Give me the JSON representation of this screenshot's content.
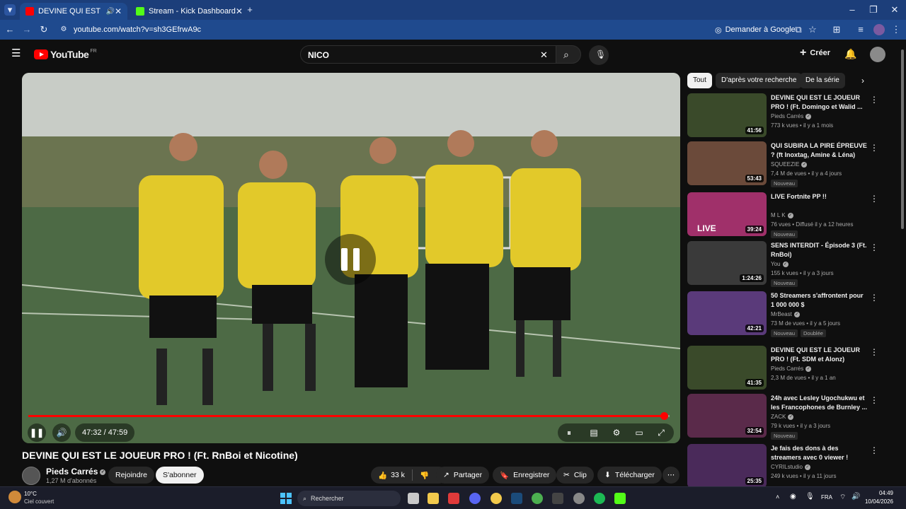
{
  "browser": {
    "tabs": [
      {
        "title": "DEVINE QUI EST LE JOUEUR",
        "active": true
      },
      {
        "title": "Stream - Kick Dashboard",
        "active": false
      }
    ],
    "url": "youtube.com/watch?v=sh3GEfrwA9c",
    "google_button": "Demander à Google"
  },
  "youtube": {
    "logo_text": "YouTube",
    "logo_region": "FR",
    "search_value": "NICO",
    "create_label": "Créer"
  },
  "player": {
    "time": "47:32 / 47:59",
    "progress": 0.991
  },
  "video": {
    "title": "DEVINE QUI EST LE JOUEUR PRO ! (Ft. RnBoi et Nicotine)",
    "channel": "Pieds Carrés",
    "subscribers": "1,27 M d'abonnés",
    "join_label": "Rejoindre",
    "subscribe_label": "S'abonner",
    "likes": "33 k",
    "share_label": "Partager",
    "save_label": "Enregistrer",
    "clip_label": "Clip",
    "download_label": "Télécharger"
  },
  "chips": [
    "Tout",
    "D'après votre recherche",
    "De la série"
  ],
  "recommendations": [
    {
      "title": "DEVINE QUI EST LE JOUEUR PRO ! (Ft. Domingo et Walid ...",
      "channel": "Pieds Carrés",
      "meta": "773 k vues • il y a 1 mois",
      "duration": "41:56",
      "badge": "",
      "badge2": "",
      "thumb_color": "#3a4a2a"
    },
    {
      "title": "QUI SUBIRA LA PIRE ÉPREUVE ? (ft Inoxtag, Amine & Léna)",
      "channel": "SQUEEZIE",
      "meta": "7,4 M de vues • il y a 4 jours",
      "duration": "53:43",
      "badge": "Nouveau",
      "badge2": "",
      "thumb_color": "#6b4a3a"
    },
    {
      "title": "LIVE Fortnite PP !!",
      "channel": "M L K",
      "meta": "76 vues • Diffusé il y a 12 heures",
      "duration": "39:24",
      "badge": "Nouveau",
      "badge2": "",
      "thumb_color": "#a0306a",
      "thumb_text": "LIVE"
    },
    {
      "title": "SENS INTERDIT - Épisode 3 (Ft. RnBoi)",
      "channel": "You",
      "meta": "155 k vues • il y a 3 jours",
      "duration": "1:24:26",
      "badge": "Nouveau",
      "badge2": "",
      "thumb_color": "#3a3a3a"
    },
    {
      "title": "50 Streamers s'affrontent pour 1 000 000 $",
      "channel": "MrBeast",
      "meta": "73 M de vues • il y a 5 jours",
      "duration": "42:21",
      "badge": "Nouveau",
      "badge2": "Doublée",
      "thumb_color": "#5a3a7a"
    },
    {
      "title": "DEVINE QUI EST LE JOUEUR PRO ! (Ft. SDM et Alonz)",
      "channel": "Pieds Carrés",
      "meta": "2,3 M de vues • il y a 1 an",
      "duration": "41:35",
      "badge": "",
      "badge2": "",
      "thumb_color": "#3a4a2a"
    },
    {
      "title": "24h avec Lesley Ugochukwu et les Francophones de Burnley ...",
      "channel": "ZACK",
      "meta": "79 k vues • il y a 3 jours",
      "duration": "32:54",
      "badge": "Nouveau",
      "badge2": "",
      "thumb_color": "#5a2a4a"
    },
    {
      "title": "Je fais des dons à des streamers avec 0 viewer !",
      "channel": "CYRILstudio",
      "meta": "249 k vues • il y a 11 jours",
      "duration": "25:35",
      "badge": "",
      "badge2": "",
      "thumb_color": "#4a2a5a"
    }
  ],
  "taskbar": {
    "weather_temp": "10°C",
    "weather_desc": "Ciel couvert",
    "search_placeholder": "Rechercher",
    "lang": "FRA",
    "time": "04:49",
    "date": "10/04/2026"
  },
  "colors": {
    "accent_red": "#ff0000",
    "tab_bar": "#1c3e7a",
    "yt_bg": "#0f0f0f"
  }
}
